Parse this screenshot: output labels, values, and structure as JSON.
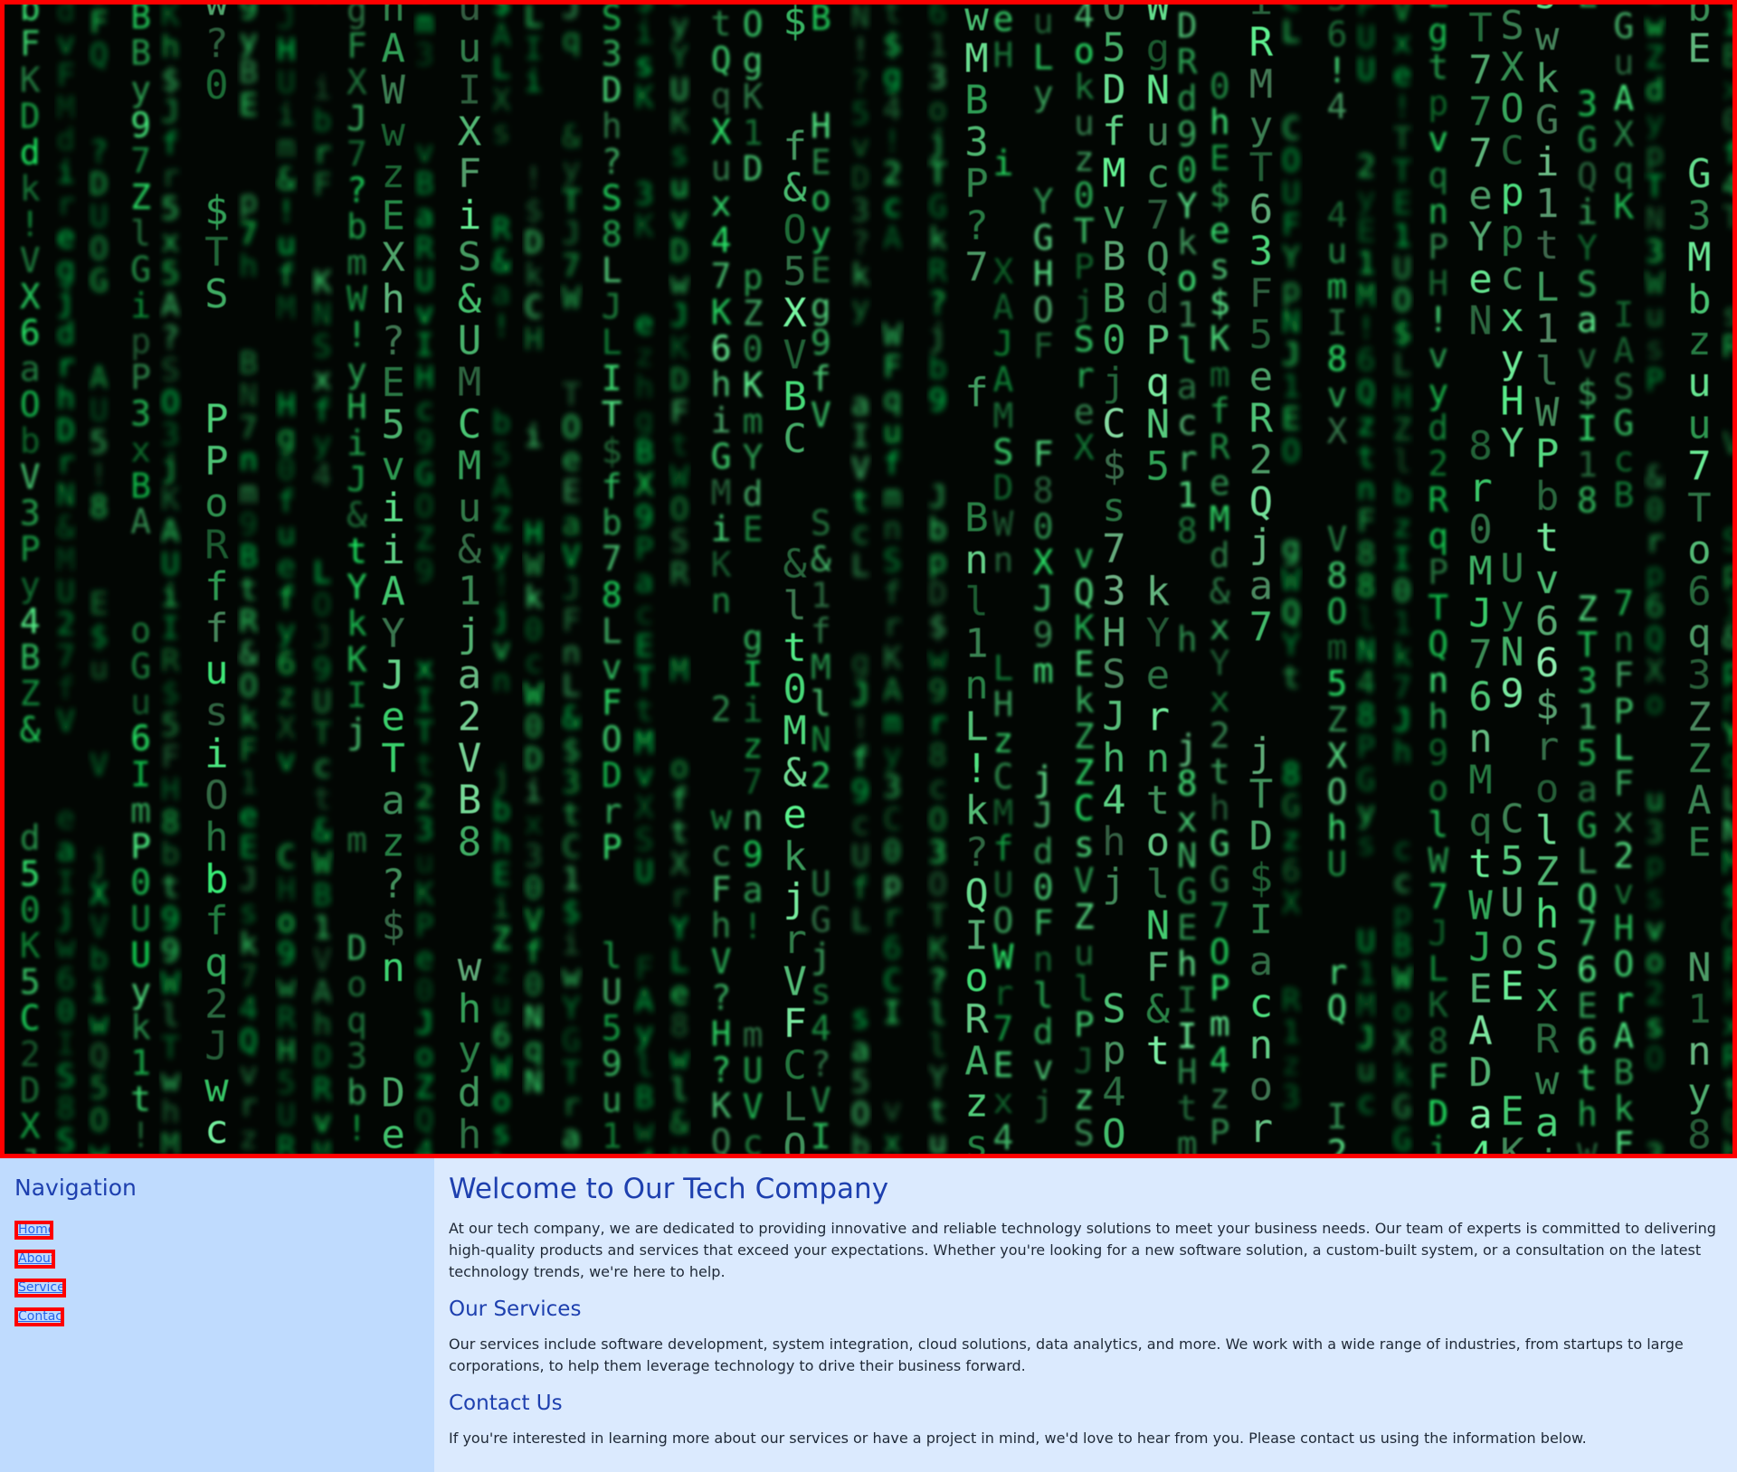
{
  "hero": {
    "image_description_icon": "digital-rain-image",
    "accent_color": "#ff0000",
    "glyph_color": "#22c55e"
  },
  "sidebar": {
    "title": "Navigation",
    "links": [
      {
        "label": "Home"
      },
      {
        "label": "About"
      },
      {
        "label": "Services"
      },
      {
        "label": "Contact"
      }
    ]
  },
  "main": {
    "welcome_title": "Welcome to Our Tech Company",
    "welcome_text": "At our tech company, we are dedicated to providing innovative and reliable technology solutions to meet your business needs. Our team of experts is committed to delivering high-quality products and services that exceed your expectations. Whether you're looking for a new software solution, a custom-built system, or a consultation on the latest technology trends, we're here to help.",
    "services_title": "Our Services",
    "services_text": "Our services include software development, system integration, cloud solutions, data analytics, and more. We work with a wide range of industries, from startups to large corporations, to help them leverage technology to drive their business forward.",
    "contact_title": "Contact Us",
    "contact_text": "If you're interested in learning more about our services or have a project in mind, we'd love to hear from you. Please contact us using the information below."
  }
}
